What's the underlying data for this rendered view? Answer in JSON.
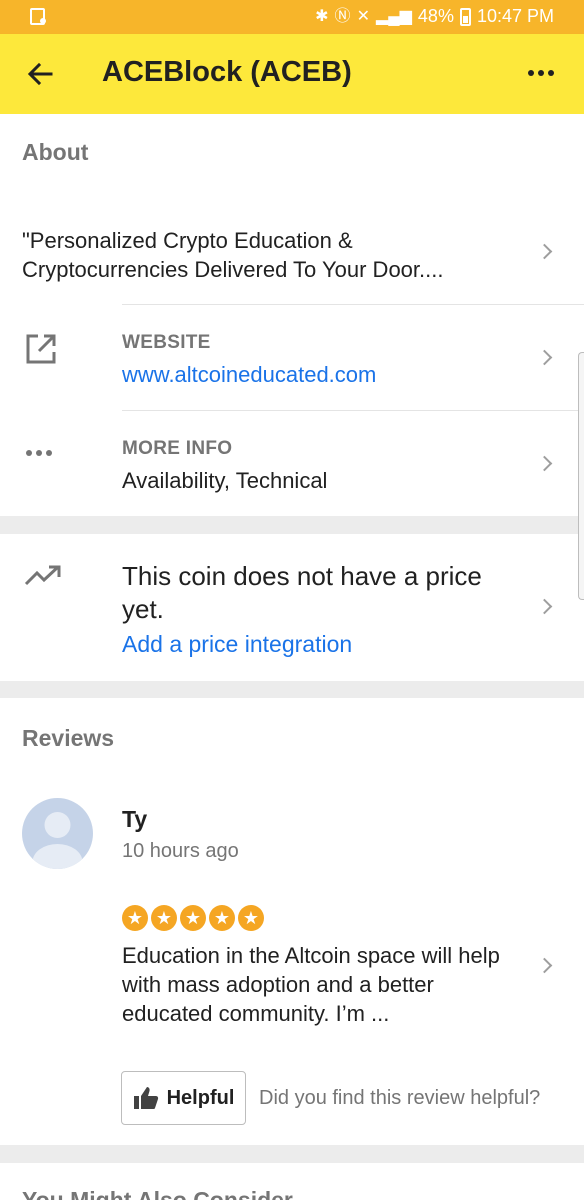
{
  "status_bar": {
    "battery": "48%",
    "time": "10:47 PM"
  },
  "appbar": {
    "title": "ACEBlock (ACEB)"
  },
  "about": {
    "section_title": "About",
    "description": "\"Personalized Crypto Education & Cryptocurrencies Delivered To Your Door....",
    "website_label": "WEBSITE",
    "website_value": "www.altcoineducated.com",
    "more_info_label": "MORE INFO",
    "more_info_value": "Availability, Technical"
  },
  "price": {
    "message": "This coin does not have a price yet.",
    "link": "Add a price integration"
  },
  "reviews": {
    "section_title": "Reviews",
    "items": [
      {
        "name": "Ty",
        "time": "10 hours ago",
        "rating": 5,
        "text": "Education in the Altcoin space will help with mass adoption and a better educated  community.  I’m ...",
        "helpful_label": "Helpful",
        "helpful_question": "Did you find this review helpful?"
      }
    ]
  },
  "consider": {
    "section_title": "You Might Also Consider"
  },
  "colors": {
    "status_bar": "#f7b52a",
    "app_bar": "#fde83b",
    "link": "#1a73e8",
    "star": "#f5a623"
  }
}
